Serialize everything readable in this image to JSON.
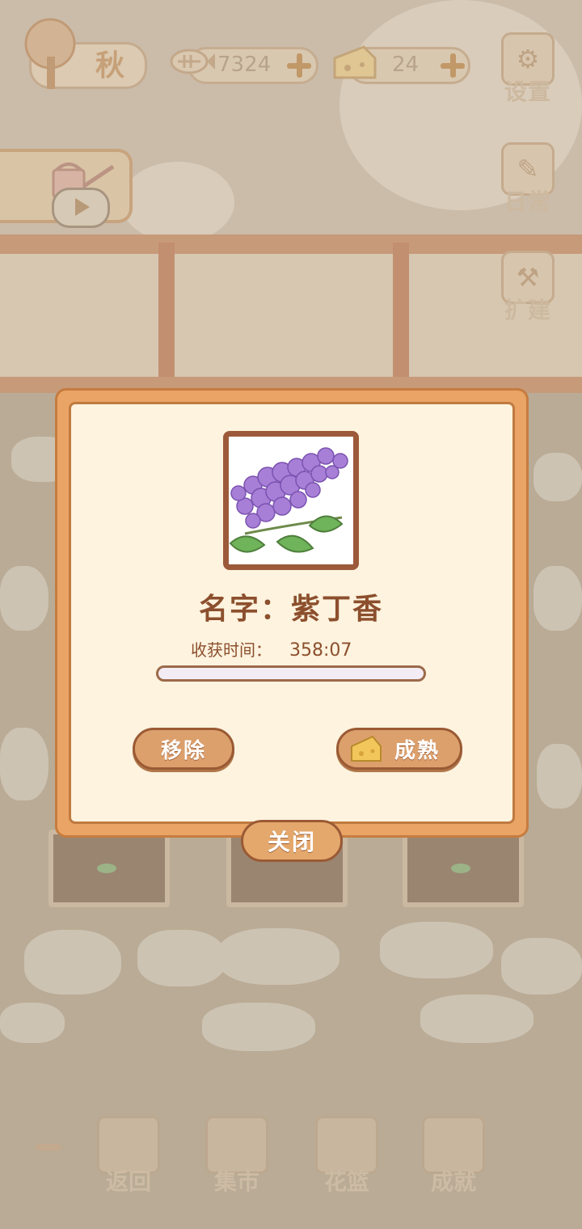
{
  "hud": {
    "season": "秋",
    "fish_count": "7324",
    "cheese_count": "24"
  },
  "side_menu": {
    "settings": "设置",
    "daily": "日常",
    "expand": "扩建"
  },
  "bottom_nav": {
    "back": "返回",
    "market": "集市",
    "basket": "花篮",
    "achievement": "成就"
  },
  "dialog": {
    "name_label": "名字：紫丁香",
    "harvest_label": "收获时间：",
    "harvest_time": "358:07",
    "progress": 0.0,
    "remove_label": "移除",
    "mature_label": "成熟",
    "close_label": "关闭",
    "flower_color": "#a77fd6"
  }
}
